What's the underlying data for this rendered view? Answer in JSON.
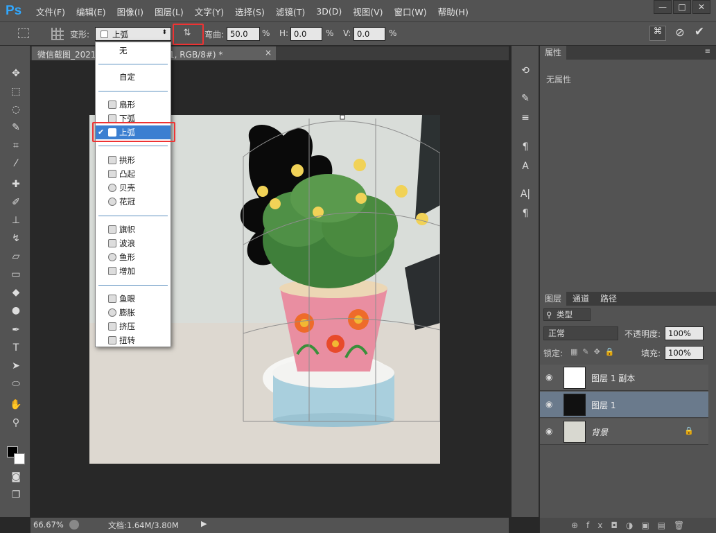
{
  "app": {
    "logo": "Ps",
    "menus": [
      "文件(F)",
      "编辑(E)",
      "图像(I)",
      "图层(L)",
      "文字(Y)",
      "选择(S)",
      "滤镜(T)",
      "3D(D)",
      "视图(V)",
      "窗口(W)",
      "帮助(H)"
    ],
    "window_controls": [
      "—",
      "□",
      "✕"
    ]
  },
  "options": {
    "warp_label": "变形:",
    "warp_value": "上弧",
    "bend_label": "弯曲:",
    "bend_value": "50.0",
    "h_label": "H:",
    "h_value": "0.0",
    "v_label": "V:",
    "v_value": "0.0",
    "percent": "%"
  },
  "document_tab": {
    "title": "微信截图_2021... @ 66.7% (图层 1, RGB/8#) *",
    "close": "×"
  },
  "warp_menu": {
    "items": [
      "无",
      "自定",
      "扇形",
      "下弧",
      "上弧",
      "拱形",
      "凸起",
      "贝壳",
      "花冠",
      "旗帜",
      "波浪",
      "鱼形",
      "增加",
      "鱼眼",
      "膨胀",
      "挤压",
      "扭转"
    ],
    "selected": "上弧"
  },
  "status": {
    "zoom": "66.67%",
    "doc_info": "文档:1.64M/3.80M"
  },
  "properties_panel": {
    "tab": "属性",
    "empty_text": "无属性"
  },
  "layers_panel": {
    "tabs": [
      "图层",
      "通道",
      "路径"
    ],
    "filter_kind": "类型",
    "blend_mode": "正常",
    "opacity_label": "不透明度:",
    "opacity": "100%",
    "lock_label": "锁定:",
    "fill_label": "填充:",
    "fill": "100%",
    "layers": [
      {
        "name": "图层 1 副本"
      },
      {
        "name": "图层 1"
      },
      {
        "name": "背景"
      }
    ]
  },
  "colors": {
    "accent": "#31a8ff",
    "highlight_box": "#e33333",
    "selected_blue": "#3b7fd1"
  }
}
